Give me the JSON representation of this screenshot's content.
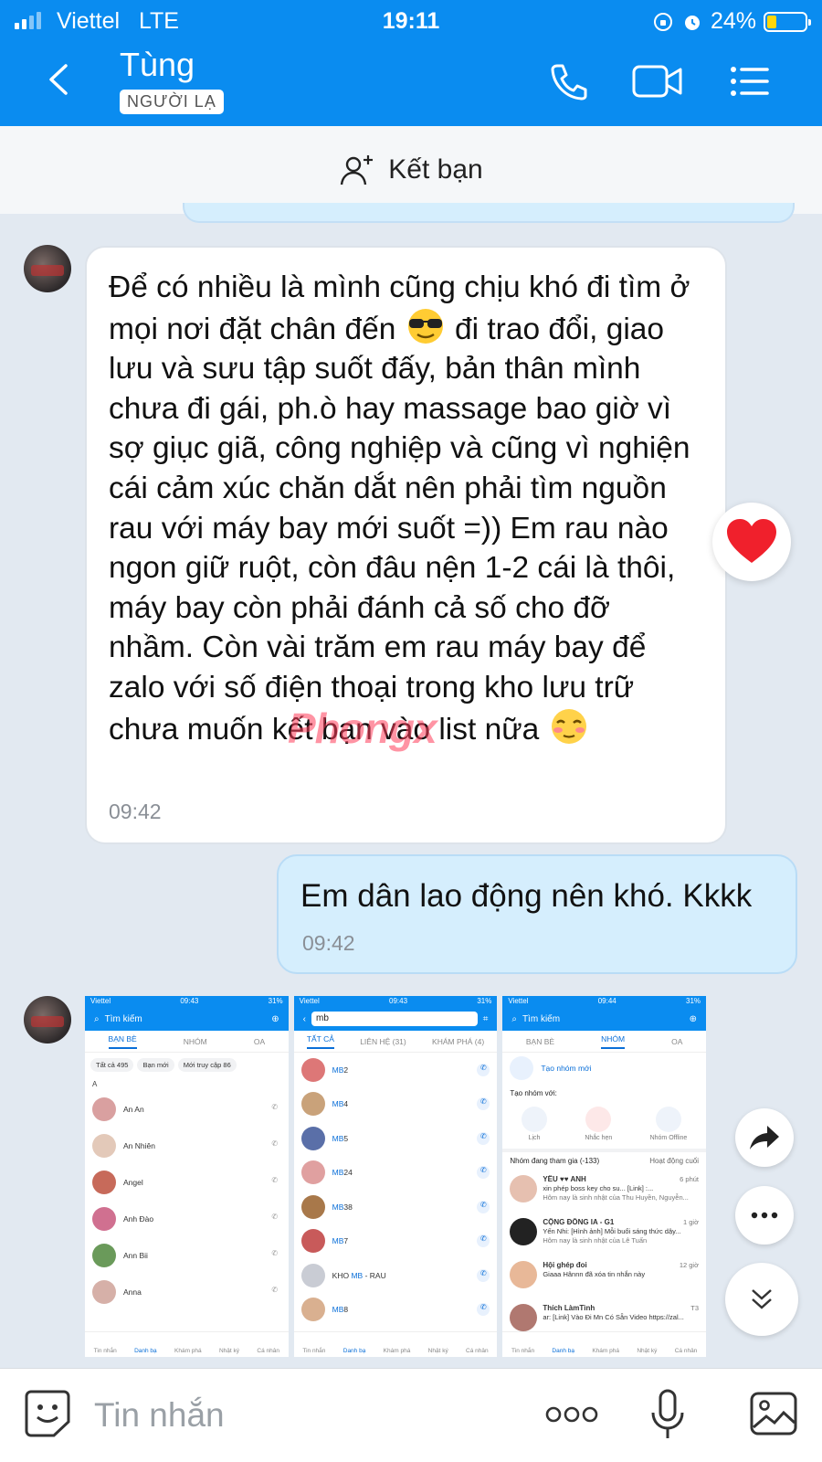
{
  "status_bar": {
    "carrier": "Viettel",
    "network": "LTE",
    "time": "19:11",
    "battery": "24%",
    "battery_level": 0.24
  },
  "header": {
    "contact_name": "Tùng",
    "badge": "NGƯỜI LẠ"
  },
  "add_friend": {
    "label": "Kết bạn"
  },
  "messages": {
    "incoming_1": {
      "part1": "Để có nhiều là mình cũng chịu khó đi tìm ở mọi nơi đặt chân đến ",
      "part2": " đi trao đổi, giao lưu và sưu tập suốt đấy, bản thân mình chưa đi gái, ph.ò hay massage bao giờ vì sợ giục giã, công nghiệp và cũng vì nghiện cái cảm xúc chăn dắt nên phải tìm nguồn rau với máy bay mới suốt =)) Em rau nào ngon giữ ruột, còn đâu nện 1-2 cái là thôi, máy bay còn phải đánh cả số cho đỡ nhầm. Còn vài trăm em rau máy bay để zalo với số điện thoại trong kho lưu trữ chưa muốn kết bạn vào list nữa ",
      "time": "09:42",
      "reaction": "heart-icon"
    },
    "outgoing_1": {
      "text": "Em dân lao động nên khó. Kkkk",
      "time": "09:42"
    }
  },
  "watermark": "Phongx",
  "screenshots": {
    "shot1": {
      "carrier": "Viettel",
      "time": "09:43",
      "battery": "31%",
      "search": "Tìm kiếm",
      "tabs": [
        "BẠN BÈ",
        "NHÓM",
        "OA"
      ],
      "chips": [
        "Tất cả  495",
        "Bạn mới",
        "Mới truy cập  86"
      ],
      "section": "A",
      "contacts": [
        "An An",
        "An Nhiên",
        "Angel",
        "Anh Đào",
        "Ann Bii",
        "Anna"
      ]
    },
    "shot2": {
      "carrier": "Viettel",
      "time": "09:43",
      "battery": "31%",
      "search": "mb",
      "tabs": [
        "TẤT CẢ",
        "LIÊN HỆ (31)",
        "KHÁM PHÁ (4)"
      ],
      "results": [
        {
          "pre": "",
          "hl": "MB",
          "post": "2"
        },
        {
          "pre": "",
          "hl": "MB",
          "post": "4"
        },
        {
          "pre": "",
          "hl": "MB",
          "post": "5"
        },
        {
          "pre": "",
          "hl": "MB",
          "post": "24"
        },
        {
          "pre": "",
          "hl": "MB",
          "post": "38"
        },
        {
          "pre": "",
          "hl": "MB",
          "post": "7"
        },
        {
          "pre": "KHO ",
          "hl": "MB",
          "post": " - RAU"
        },
        {
          "pre": "",
          "hl": "MB",
          "post": "8"
        }
      ]
    },
    "shot3": {
      "carrier": "Viettel",
      "time": "09:44",
      "battery": "31%",
      "search": "Tìm kiếm",
      "tabs": [
        "BẠN BÈ",
        "NHÓM",
        "OA"
      ],
      "create_group": "Tạo nhóm mới",
      "create_with": "Tạo nhóm với:",
      "create_options": [
        "Lịch",
        "Nhắc hẹn",
        "Nhóm Offline"
      ],
      "joined": "Nhóm đang tham gia (-133)",
      "sort": "Hoạt động cuối",
      "groups": [
        {
          "name": "YÊU ♥♥ ANH",
          "time": "6 phút",
          "line1": "xin phép boss key cho su... [Link] :...",
          "line2": "Hôm nay là sinh nhật của Thu Huyền, Nguyễn..."
        },
        {
          "name": "CỘNG ĐỒNG IA - G1",
          "time": "1 giờ",
          "line1": "Yến Nhi: [Hình ảnh] Mỗi buổi sáng thức dậy...",
          "line2": "Hôm nay là sinh nhật của Lê Tuấn"
        },
        {
          "name": "Hội ghép đoi",
          "time": "12 giờ",
          "line1": "Giaaa Hânnn đã xóa tin nhắn này",
          "line2": ""
        },
        {
          "name": "Thích LàmTình",
          "time": "T3",
          "line1": "ar: [Link] Vào Đi Mn Có Sẵn Video https://zal...",
          "line2": ""
        }
      ]
    },
    "nav": [
      "Tin nhắn",
      "Danh bạ",
      "Khám phá",
      "Nhật ký",
      "Cá nhân"
    ]
  },
  "input_bar": {
    "placeholder": "Tin nhắn"
  }
}
